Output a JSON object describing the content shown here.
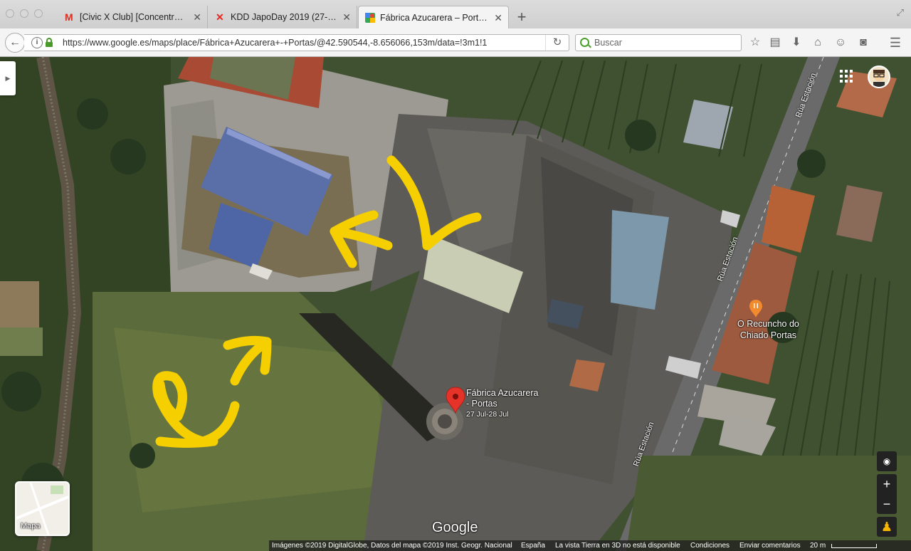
{
  "browser": {
    "tabs": [
      {
        "title": "[Civic X Club] [Concentraci…",
        "icon": "gmail-icon",
        "active": false
      },
      {
        "title": "KDD JapoDay 2019 (27-2…",
        "icon": "x-icon",
        "active": false
      },
      {
        "title": "Fábrica Azucarera – Porta…",
        "icon": "google-maps-icon",
        "active": true
      }
    ],
    "new_tab": "+",
    "url": "https://www.google.es/maps/place/Fábrica+Azucarera+-+Portas/@42.590544,-8.656066,153m/data=!3m1!1",
    "search_placeholder": "Buscar"
  },
  "map": {
    "place": {
      "name_line1": "Fábrica Azucarera",
      "name_line2": "- Portas",
      "dates": "27 Jul-28 Jul"
    },
    "restaurant": {
      "line1": "O Recuncho do",
      "line2": "Chiado Portas"
    },
    "roads": [
      "Rúa Estación",
      "Rúa Estación",
      "Rúa Estación"
    ],
    "watermark": "© 2019 Google",
    "minimap_label": "Mapa",
    "logo": "Google",
    "zoom_in": "+",
    "zoom_out": "−",
    "accent_color": "#f5cf00",
    "pin_color": "#e5332a"
  },
  "footer": {
    "imagery": "Imágenes ©2019 DigitalGlobe, Datos del mapa ©2019 Inst. Geogr. Nacional",
    "country": "España",
    "no3d": "La vista Tierra en 3D no está disponible",
    "terms": "Condiciones",
    "feedback": "Enviar comentarios",
    "scale": "20 m"
  }
}
